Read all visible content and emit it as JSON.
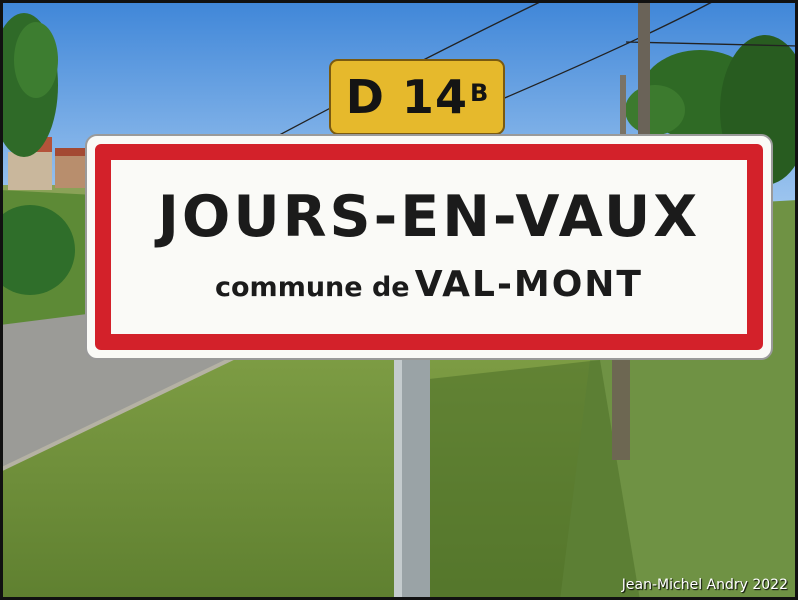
{
  "route_plate": {
    "road": "D 14",
    "suffix": "B"
  },
  "sign": {
    "town": "JOURS-EN-VAUX",
    "commune_prefix": "commune de",
    "commune_name": "VAL-MONT"
  },
  "credit": "Jean-Michel Andry 2022",
  "colors": {
    "sky": "#4a90dc",
    "grass": "#6c8e38",
    "sign_red": "#d3212a",
    "plate_yellow": "#e6b92c"
  }
}
